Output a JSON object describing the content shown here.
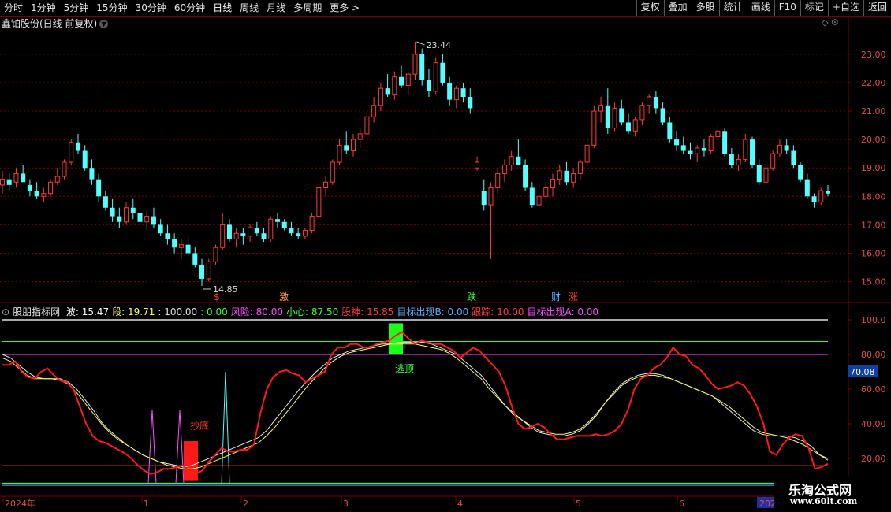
{
  "toolbar": {
    "periods": [
      {
        "label": "分时",
        "active": false
      },
      {
        "label": "1分钟",
        "active": false
      },
      {
        "label": "5分钟",
        "active": false
      },
      {
        "label": "15分钟",
        "active": false
      },
      {
        "label": "30分钟",
        "active": false
      },
      {
        "label": "60分钟",
        "active": false
      },
      {
        "label": "日线",
        "active": true
      },
      {
        "label": "周线",
        "active": false
      },
      {
        "label": "月线",
        "active": false
      },
      {
        "label": "多周期",
        "active": false
      },
      {
        "label": "更多 >",
        "active": false
      }
    ],
    "actions": [
      "复权",
      "叠加",
      "多股",
      "统计",
      "画线",
      "F10",
      "标记",
      "+自选",
      "返回"
    ]
  },
  "stock": {
    "title": "鑫铂股份(日线 前复权)"
  },
  "price_axis": {
    "ticks": [
      "23.00",
      "22.00",
      "21.00",
      "20.00",
      "19.00",
      "18.00",
      "17.00",
      "16.00",
      "15.00"
    ]
  },
  "price_labels": {
    "high": "23.44",
    "low": "14.85"
  },
  "markers": [
    {
      "label": "$",
      "color": "#ff3a3a"
    },
    {
      "label": "激",
      "color": "#ff9a3a"
    },
    {
      "label": "跌",
      "color": "#3aff3a"
    },
    {
      "label": "财",
      "color": "#5ab0ff"
    },
    {
      "label": "涨",
      "color": "#ff3a3a"
    }
  ],
  "indicator": {
    "name": "股朋指标网",
    "items": [
      {
        "text": "波: 15.47",
        "color": "#ffffff"
      },
      {
        "text": "段: 19.71",
        "color": "#ffff60"
      },
      {
        "text": ": 100.00",
        "color": "#e0e0e0"
      },
      {
        "text": ": 0.00",
        "color": "#3aff3a"
      },
      {
        "text": "风险: 80.00",
        "color": "#ff50ff"
      },
      {
        "text": "小心: 87.50",
        "color": "#3aff3a"
      },
      {
        "text": "股神: 15.85",
        "color": "#ff3a3a"
      },
      {
        "text": "目标出现B: 0.00",
        "color": "#5ab0ff"
      },
      {
        "text": "跟踪: 10.00",
        "color": "#ff3a3a"
      },
      {
        "text": "目标出现A: 0.00",
        "color": "#ff50ff"
      }
    ],
    "axis": [
      "100.0",
      "80.00",
      "60.00",
      "40.00",
      "20.00"
    ],
    "current": "70.08",
    "signal_top": "逃顶",
    "signal_bottom": "抄底"
  },
  "date_axis": {
    "labels": [
      "2024年",
      "1",
      "2",
      "3",
      "4",
      "5",
      "6",
      "202"
    ]
  },
  "watermark": {
    "name": "乐淘公式网",
    "url": "www.60lt.com"
  },
  "colors": {
    "up": "#ff3a3a",
    "down": "#54ffff",
    "frame": "#7a0000",
    "grid": "#7a0000"
  },
  "chart_data": {
    "type": "candlestick",
    "ylim": [
      14.6,
      23.8
    ],
    "candles": [
      [
        18.4,
        18.9,
        18.1,
        18.6
      ],
      [
        18.6,
        18.8,
        18.2,
        18.4
      ],
      [
        18.5,
        19.0,
        18.3,
        18.8
      ],
      [
        18.8,
        19.1,
        18.6,
        18.5
      ],
      [
        18.4,
        18.6,
        18.0,
        18.2
      ],
      [
        18.2,
        18.5,
        17.9,
        18.0
      ],
      [
        18.0,
        18.3,
        17.8,
        18.1
      ],
      [
        18.1,
        18.6,
        18.0,
        18.5
      ],
      [
        18.5,
        19.0,
        18.4,
        18.7
      ],
      [
        18.7,
        19.3,
        18.6,
        19.2
      ],
      [
        19.2,
        20.0,
        19.1,
        19.9
      ],
      [
        19.9,
        20.2,
        19.5,
        19.6
      ],
      [
        19.6,
        19.8,
        18.9,
        19.0
      ],
      [
        19.0,
        19.3,
        18.4,
        18.6
      ],
      [
        18.6,
        18.8,
        17.8,
        18.0
      ],
      [
        18.0,
        18.2,
        17.5,
        17.6
      ],
      [
        17.6,
        17.9,
        17.1,
        17.3
      ],
      [
        17.3,
        17.6,
        16.9,
        17.1
      ],
      [
        17.1,
        17.8,
        17.0,
        17.6
      ],
      [
        17.6,
        17.9,
        17.2,
        17.4
      ],
      [
        17.4,
        17.7,
        17.0,
        17.1
      ],
      [
        17.1,
        17.5,
        16.8,
        17.3
      ],
      [
        17.3,
        17.6,
        16.9,
        17.0
      ],
      [
        17.0,
        17.2,
        16.6,
        16.7
      ],
      [
        16.7,
        17.0,
        16.3,
        16.5
      ],
      [
        16.5,
        16.7,
        16.0,
        16.2
      ],
      [
        16.2,
        16.5,
        15.8,
        16.3
      ],
      [
        16.3,
        16.6,
        15.9,
        16.0
      ],
      [
        16.0,
        16.2,
        15.5,
        15.6
      ],
      [
        15.6,
        15.8,
        14.85,
        15.1
      ],
      [
        15.1,
        15.8,
        15.0,
        15.7
      ],
      [
        15.7,
        16.3,
        15.6,
        16.2
      ],
      [
        16.2,
        17.4,
        16.1,
        17.0
      ],
      [
        17.0,
        17.2,
        16.4,
        16.5
      ],
      [
        16.5,
        16.9,
        16.2,
        16.7
      ],
      [
        16.7,
        16.9,
        16.3,
        16.6
      ],
      [
        16.6,
        17.0,
        16.4,
        16.9
      ],
      [
        16.9,
        17.1,
        16.6,
        16.7
      ],
      [
        16.7,
        16.9,
        16.4,
        16.5
      ],
      [
        16.5,
        17.3,
        16.4,
        17.2
      ],
      [
        17.2,
        17.4,
        16.9,
        17.1
      ],
      [
        17.1,
        17.2,
        16.8,
        16.9
      ],
      [
        16.9,
        17.1,
        16.6,
        16.7
      ],
      [
        16.7,
        16.9,
        16.5,
        16.6
      ],
      [
        16.6,
        16.9,
        16.5,
        16.8
      ],
      [
        16.8,
        17.4,
        16.7,
        17.3
      ],
      [
        17.3,
        18.5,
        17.2,
        18.3
      ],
      [
        18.3,
        18.7,
        18.0,
        18.5
      ],
      [
        18.5,
        19.3,
        18.4,
        19.2
      ],
      [
        19.2,
        20.0,
        19.1,
        19.8
      ],
      [
        19.8,
        20.3,
        19.5,
        19.6
      ],
      [
        19.6,
        20.2,
        19.4,
        20.0
      ],
      [
        20.0,
        20.4,
        19.7,
        20.2
      ],
      [
        20.2,
        21.0,
        20.1,
        20.8
      ],
      [
        20.8,
        21.5,
        20.6,
        21.2
      ],
      [
        21.2,
        22.0,
        21.0,
        21.8
      ],
      [
        21.8,
        22.3,
        21.5,
        21.6
      ],
      [
        21.6,
        22.4,
        21.4,
        22.2
      ],
      [
        22.2,
        22.6,
        21.8,
        21.9
      ],
      [
        21.9,
        22.4,
        21.6,
        22.3
      ],
      [
        22.3,
        23.44,
        22.1,
        23.0
      ],
      [
        23.0,
        23.2,
        21.9,
        22.1
      ],
      [
        22.1,
        22.5,
        21.5,
        21.7
      ],
      [
        21.7,
        22.9,
        21.6,
        22.7
      ],
      [
        22.7,
        23.0,
        21.9,
        22.0
      ],
      [
        22.0,
        22.2,
        21.2,
        21.4
      ],
      [
        21.4,
        21.9,
        21.1,
        21.8
      ],
      [
        21.8,
        22.0,
        21.3,
        21.5
      ],
      [
        21.5,
        21.8,
        20.9,
        21.1
      ],
      [
        19.0,
        19.4,
        18.9,
        19.2
      ],
      [
        18.2,
        18.6,
        17.5,
        17.7
      ],
      [
        17.7,
        18.5,
        15.8,
        18.3
      ],
      [
        18.3,
        19.0,
        18.1,
        18.8
      ],
      [
        18.8,
        19.3,
        18.5,
        19.1
      ],
      [
        19.1,
        19.6,
        18.9,
        19.4
      ],
      [
        19.4,
        20.0,
        19.2,
        19.1
      ],
      [
        19.1,
        19.3,
        18.2,
        18.3
      ],
      [
        18.3,
        18.5,
        17.6,
        17.7
      ],
      [
        17.7,
        18.2,
        17.5,
        18.0
      ],
      [
        18.0,
        18.5,
        17.8,
        18.3
      ],
      [
        18.3,
        18.8,
        18.0,
        18.6
      ],
      [
        18.6,
        19.1,
        18.4,
        18.9
      ],
      [
        18.9,
        19.2,
        18.4,
        18.5
      ],
      [
        18.5,
        19.0,
        18.3,
        18.8
      ],
      [
        18.8,
        19.3,
        18.6,
        19.2
      ],
      [
        19.2,
        20.0,
        19.1,
        19.8
      ],
      [
        19.8,
        21.2,
        19.7,
        21.0
      ],
      [
        21.0,
        21.5,
        20.6,
        21.2
      ],
      [
        21.2,
        21.8,
        20.2,
        20.4
      ],
      [
        20.4,
        21.3,
        20.3,
        21.1
      ],
      [
        21.1,
        21.4,
        20.5,
        20.6
      ],
      [
        20.6,
        20.9,
        20.2,
        20.3
      ],
      [
        20.3,
        20.8,
        20.1,
        20.7
      ],
      [
        20.7,
        21.3,
        20.5,
        21.2
      ],
      [
        21.2,
        21.6,
        20.9,
        21.5
      ],
      [
        21.5,
        21.7,
        20.9,
        21.1
      ],
      [
        21.1,
        21.3,
        20.5,
        20.6
      ],
      [
        20.6,
        20.8,
        19.9,
        20.0
      ],
      [
        20.0,
        20.3,
        19.6,
        19.8
      ],
      [
        19.8,
        20.1,
        19.5,
        19.6
      ],
      [
        19.6,
        19.9,
        19.3,
        19.5
      ],
      [
        19.5,
        19.8,
        19.2,
        19.7
      ],
      [
        19.7,
        20.0,
        19.4,
        19.6
      ],
      [
        19.6,
        20.2,
        19.5,
        20.1
      ],
      [
        20.1,
        20.5,
        19.9,
        20.3
      ],
      [
        20.3,
        20.4,
        19.4,
        19.5
      ],
      [
        19.5,
        19.7,
        19.0,
        19.1
      ],
      [
        19.1,
        19.5,
        18.9,
        19.3
      ],
      [
        19.3,
        20.2,
        19.2,
        20.0
      ],
      [
        20.0,
        20.1,
        19.0,
        19.1
      ],
      [
        19.1,
        19.3,
        18.4,
        18.5
      ],
      [
        18.5,
        19.2,
        18.4,
        19.0
      ],
      [
        19.0,
        19.6,
        18.9,
        19.5
      ],
      [
        19.5,
        20.0,
        19.4,
        19.8
      ],
      [
        19.8,
        20.0,
        19.5,
        19.6
      ],
      [
        19.6,
        19.8,
        19.0,
        19.1
      ],
      [
        19.1,
        19.2,
        18.5,
        18.6
      ],
      [
        18.6,
        18.8,
        17.9,
        18.0
      ],
      [
        18.0,
        18.1,
        17.6,
        17.8
      ],
      [
        17.8,
        18.3,
        17.7,
        18.2
      ],
      [
        18.2,
        18.4,
        18.0,
        18.1
      ]
    ],
    "indicator_lines": {
      "red": [
        74,
        74,
        76,
        70,
        67,
        66,
        70,
        72,
        68,
        65,
        64,
        60,
        50,
        40,
        33,
        30,
        29,
        27,
        25,
        23,
        20,
        16,
        13,
        11,
        12,
        14,
        14,
        15,
        16,
        12,
        11,
        13,
        18,
        22,
        26,
        24,
        24,
        25,
        25,
        28,
        46,
        60,
        67,
        70,
        71,
        69,
        68,
        64,
        66,
        68,
        70,
        80,
        84,
        84,
        86,
        86,
        84,
        84,
        86,
        87,
        88,
        91,
        93,
        89,
        86,
        88,
        87,
        86,
        86,
        84,
        82,
        78,
        81,
        84,
        82,
        78,
        74,
        70,
        62,
        50,
        40,
        37,
        38,
        40,
        38,
        34,
        31,
        31,
        32,
        33,
        33,
        33,
        34,
        33,
        34,
        36,
        40,
        48,
        60,
        66,
        68,
        72,
        74,
        78,
        84,
        80,
        79,
        74,
        72,
        68,
        63,
        60,
        61,
        62,
        64,
        62,
        57,
        50,
        40,
        24,
        22,
        28,
        32,
        34,
        33,
        26,
        14,
        15,
        17
      ],
      "white": [
        80,
        78,
        74,
        70,
        67,
        66,
        66,
        66,
        64,
        60,
        54,
        48,
        41,
        36,
        32,
        28,
        25,
        22,
        20,
        18,
        17,
        16,
        15,
        16,
        18,
        20,
        22,
        24,
        26,
        28,
        30,
        32,
        36,
        42,
        48,
        54,
        60,
        65,
        70,
        74,
        78,
        80,
        82,
        83,
        84,
        85,
        86,
        86,
        87,
        87,
        87,
        87,
        86,
        84,
        82,
        80,
        76,
        72,
        68,
        62,
        56,
        50,
        45,
        42,
        38,
        35,
        34,
        33,
        33,
        34,
        36,
        40,
        45,
        52,
        58,
        63,
        66,
        68,
        69,
        69,
        68,
        66,
        64,
        62,
        60,
        58,
        56,
        52,
        48,
        44,
        40,
        36,
        34,
        33,
        33,
        33,
        32,
        30,
        27,
        22,
        20
      ],
      "yellow": [
        78,
        76,
        72,
        68,
        66,
        66,
        66,
        65,
        63,
        58,
        52,
        46,
        40,
        35,
        31,
        28,
        25,
        22,
        20,
        18,
        16,
        15,
        14,
        14,
        15,
        17,
        19,
        21,
        23,
        25,
        27,
        29,
        33,
        38,
        44,
        50,
        56,
        62,
        67,
        72,
        76,
        79,
        81,
        82,
        83,
        84,
        85,
        86,
        86,
        86,
        86,
        85,
        84,
        83,
        81,
        78,
        74,
        70,
        66,
        60,
        55,
        50,
        46,
        42,
        39,
        36,
        35,
        34,
        34,
        35,
        37,
        41,
        46,
        52,
        57,
        62,
        65,
        67,
        68,
        68,
        67,
        66,
        64,
        62,
        60,
        58,
        56,
        53,
        50,
        46,
        42,
        38,
        35,
        34,
        33,
        32,
        30,
        28,
        25,
        22,
        19
      ]
    }
  }
}
